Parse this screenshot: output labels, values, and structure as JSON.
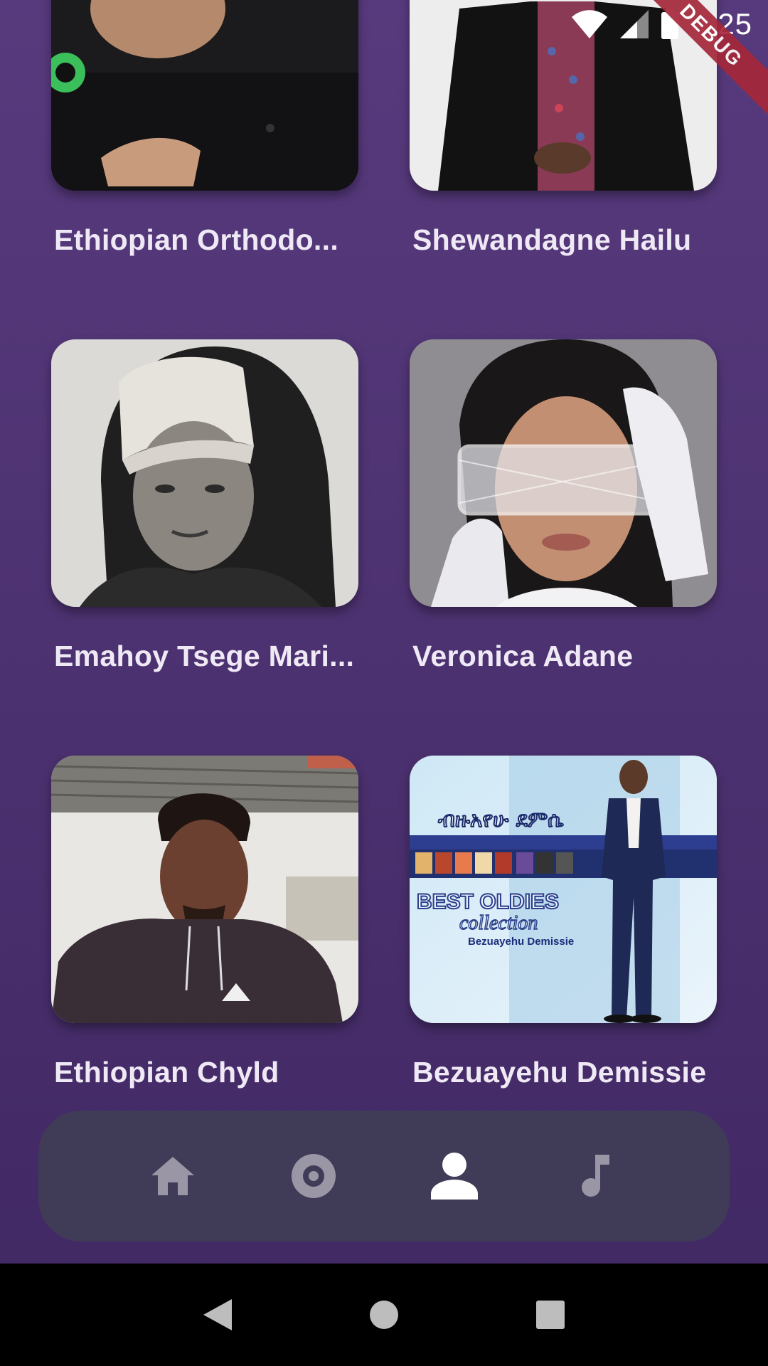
{
  "status_bar": {
    "time": "4:25",
    "debug_label": "DEBUG"
  },
  "artists": [
    {
      "name": "Ethiopian Orthodo..."
    },
    {
      "name": "Shewandagne Hailu"
    },
    {
      "name": "Emahoy Tsege Mari..."
    },
    {
      "name": "Veronica Adane"
    },
    {
      "name": "Ethiopian Chyld"
    },
    {
      "name": "Bezuayehu Demissie"
    }
  ],
  "album_art_text": {
    "amharic_title": "ብዙአየሁ ደምሴ",
    "line1": "BEST OLDIES",
    "line2": "collection",
    "line3": "Bezuayehu Demissie"
  },
  "bottom_nav": {
    "items": [
      {
        "icon": "home-icon",
        "active": false
      },
      {
        "icon": "album-icon",
        "active": false
      },
      {
        "icon": "person-icon",
        "active": true
      },
      {
        "icon": "music-note-icon",
        "active": false
      }
    ]
  },
  "colors": {
    "background_top": "#573a7d",
    "background_bottom": "#402863",
    "nav_background": "#403b57",
    "nav_icon_inactive": "#9a96a6",
    "nav_icon_active": "#ffffff",
    "debug_banner": "#a5283a"
  }
}
